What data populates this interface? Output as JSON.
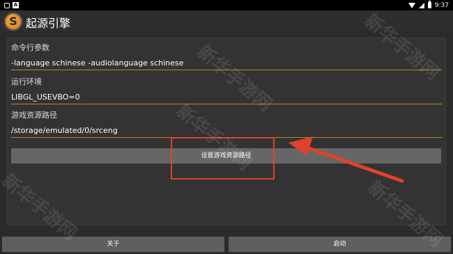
{
  "status_bar": {
    "time": "9:37"
  },
  "app": {
    "title": "起源引擎",
    "logo_letter": "S"
  },
  "form": {
    "fields": [
      {
        "label": "命令行参数",
        "value": "-language schinese -audiolanguage schinese"
      },
      {
        "label": "运行环境",
        "value": "LIBGL_USEVBO=0"
      },
      {
        "label": "游戏资源路径",
        "value": "/storage/emulated/0/srceng"
      }
    ],
    "set_path_button": "设置游戏资源路径"
  },
  "bottom": {
    "about_button": "关于",
    "launch_button": "启动"
  },
  "watermark": {
    "text": "新华手游网"
  },
  "colors": {
    "accent": "#c9821d",
    "highlight": "#e0432a"
  }
}
